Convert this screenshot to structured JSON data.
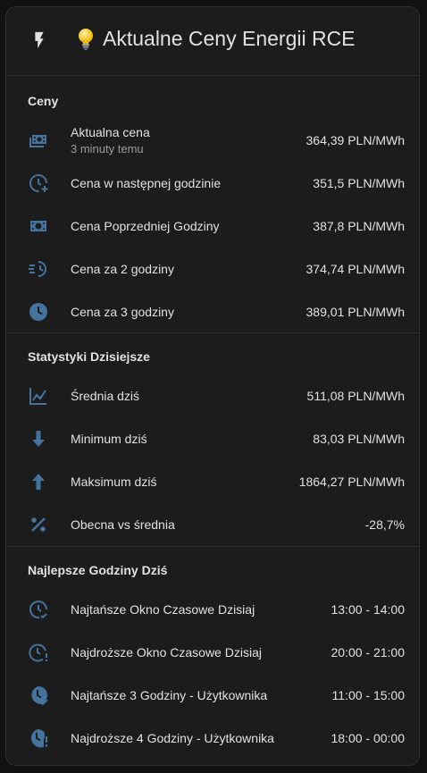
{
  "colors": {
    "icon": "#44739e",
    "background": "#1c1c1c",
    "text": "#e1e1e1",
    "secondary": "#9b9b9b"
  },
  "header": {
    "title": "Aktualne Ceny Energii RCE",
    "icon": "flash-icon",
    "emoji": "💡"
  },
  "sections": [
    {
      "title": "Ceny",
      "rows": [
        {
          "icon": "cash-multiple-icon",
          "label": "Aktualna cena",
          "sub": "3 minuty temu",
          "value": "364,39 PLN/MWh"
        },
        {
          "icon": "clock-plus-icon",
          "label": "Cena w następnej godzinie",
          "value": "351,5 PLN/MWh"
        },
        {
          "icon": "cash-icon",
          "label": "Cena Poprzedniej Godziny",
          "value": "387,8 PLN/MWh"
        },
        {
          "icon": "clock-fast-icon",
          "label": "Cena za 2 godziny",
          "value": "374,74 PLN/MWh"
        },
        {
          "icon": "clock-icon",
          "label": "Cena za 3 godziny",
          "value": "389,01 PLN/MWh"
        }
      ]
    },
    {
      "title": "Statystyki Dzisiejsze",
      "rows": [
        {
          "icon": "chart-line-icon",
          "label": "Średnia dziś",
          "value": "511,08 PLN/MWh"
        },
        {
          "icon": "arrow-down-icon",
          "label": "Minimum dziś",
          "value": "83,03 PLN/MWh"
        },
        {
          "icon": "arrow-up-icon",
          "label": "Maksimum dziś",
          "value": "1864,27 PLN/MWh"
        },
        {
          "icon": "percent-icon",
          "label": "Obecna vs średnia",
          "value": "-28,7%"
        }
      ]
    },
    {
      "title": "Najlepsze Godziny Dziś",
      "rows": [
        {
          "icon": "clock-check-icon",
          "label": "Najtańsze Okno Czasowe Dzisiaj",
          "value": "13:00 - 14:00"
        },
        {
          "icon": "clock-alert-icon",
          "label": "Najdroższe Okno Czasowe Dzisiaj",
          "value": "20:00 - 21:00"
        },
        {
          "icon": "clock-check-filled-icon",
          "label": "Najtańsze 3 Godziny - Użytkownika",
          "value": "11:00 - 15:00"
        },
        {
          "icon": "clock-alert-filled-icon",
          "label": "Najdroższe 4 Godziny - Użytkownika",
          "value": "18:00 - 00:00"
        }
      ]
    }
  ]
}
